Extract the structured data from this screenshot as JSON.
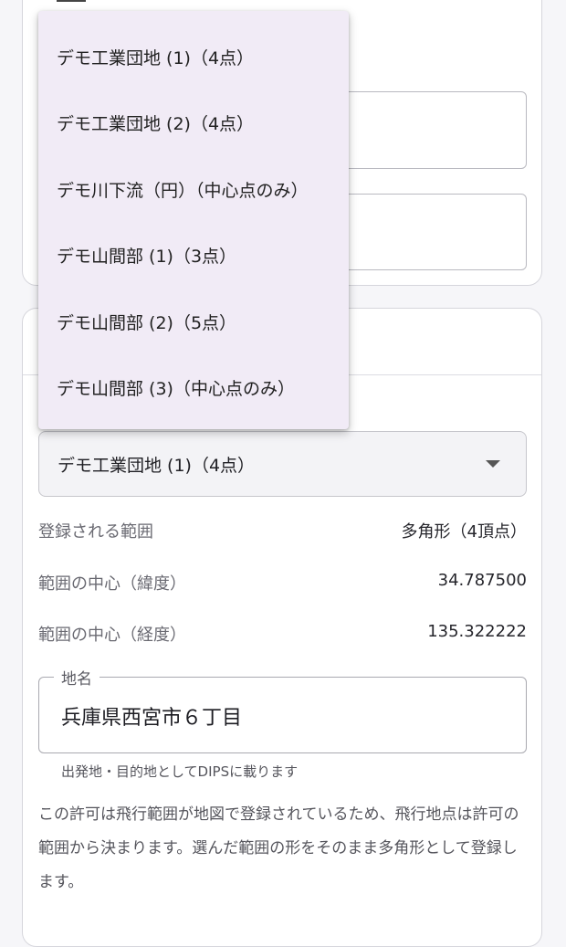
{
  "menu": {
    "items": [
      "デモ工業団地 (1)（4点）",
      "デモ工業団地 (2)（4点）",
      "デモ川下流（円）（中心点のみ）",
      "デモ山間部 (1)（3点）",
      "デモ山間部 (2)（5点）",
      "デモ山間部 (3)（中心点のみ）"
    ]
  },
  "select": {
    "value": "デモ工業団地 (1)（4点）"
  },
  "info": {
    "range_label": "登録される範囲",
    "range_value": "多角形（4頂点）",
    "lat_label": "範囲の中心（緯度）",
    "lat_value": "34.787500",
    "lng_label": "範囲の中心（経度）",
    "lng_value": "135.322222"
  },
  "place": {
    "label": "地名",
    "value": "兵庫県西宮市６丁目",
    "helper": "出発地・目的地としてDIPSに載ります"
  },
  "note": "この許可は飛行範囲が地図で登録されているため、飛行地点は許可の範囲から決まります。選んだ範囲の形をそのまま多角形として登録します。",
  "colors": {
    "menu_bg": "#f1ebf6",
    "select_bg": "#f3f3f6"
  }
}
